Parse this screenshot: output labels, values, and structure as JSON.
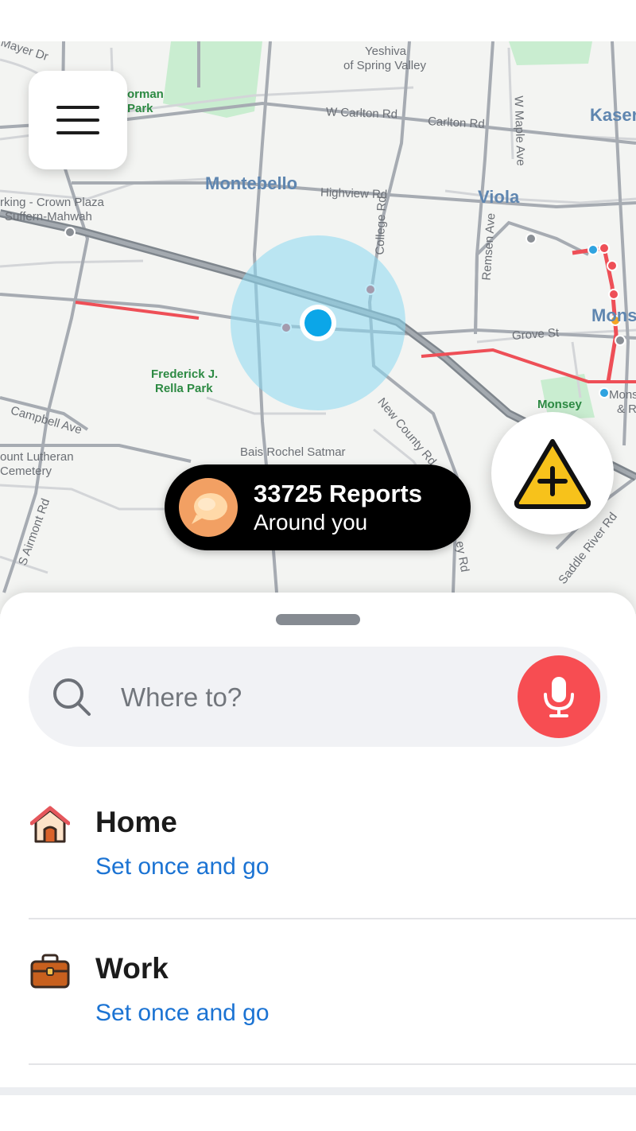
{
  "map": {
    "labels": {
      "mayer_dr": "Mayer Dr",
      "yeshiva": "Yeshiva",
      "of_spring_valley": "of Spring Valley",
      "norman": "orman",
      "park": "Park",
      "w_carlton": "W Carlton Rd",
      "carlton": "Carlton Rd",
      "maple": "W Maple Ave",
      "kaser": "Kaser",
      "montebello": "Montebello",
      "highview": "Highview Rd",
      "viola": "Viola",
      "parking_1": "rking - Crown Plaza",
      "parking_2": "Suffern-Mahwah",
      "college": "College Rd",
      "remsen": "Remsen Ave",
      "monsey_city": "Mons",
      "grove": "Grove St",
      "frederick_1": "Frederick J.",
      "frederick_2": "Rella Park",
      "campbell": "Campbell Ave",
      "new_county": "New County Rd",
      "monsey_park": "Monsey",
      "monsey_right_1": "Monse",
      "monsey_right_2": "& R",
      "bais_rochel": "Bais Rochel Satmar",
      "lutheran_1": "ount Lutheran",
      "lutheran_2": "Cemetery",
      "airmont": "S Airmont Rd",
      "saddle_river": "Saddle River Rd",
      "ey_rd": "ey Rd"
    }
  },
  "menu": {
    "icon": "hamburger-menu-icon"
  },
  "reports": {
    "count_label": "33725 Reports",
    "sub_label": "Around you",
    "avatar_color": "#f2a063"
  },
  "report_button": {
    "icon": "report-hazard-plus-icon",
    "color": "#f7c21b"
  },
  "search": {
    "placeholder": "Where to?",
    "mic_color": "#f74d52"
  },
  "places": [
    {
      "title": "Home",
      "subtitle": "Set once and go",
      "icon": "home-icon"
    },
    {
      "title": "Work",
      "subtitle": "Set once and go",
      "icon": "briefcase-icon"
    }
  ],
  "colors": {
    "accent_blue": "#1b73d3",
    "location_blue": "#0ba6e8",
    "map_bg": "#f3f4f2"
  }
}
